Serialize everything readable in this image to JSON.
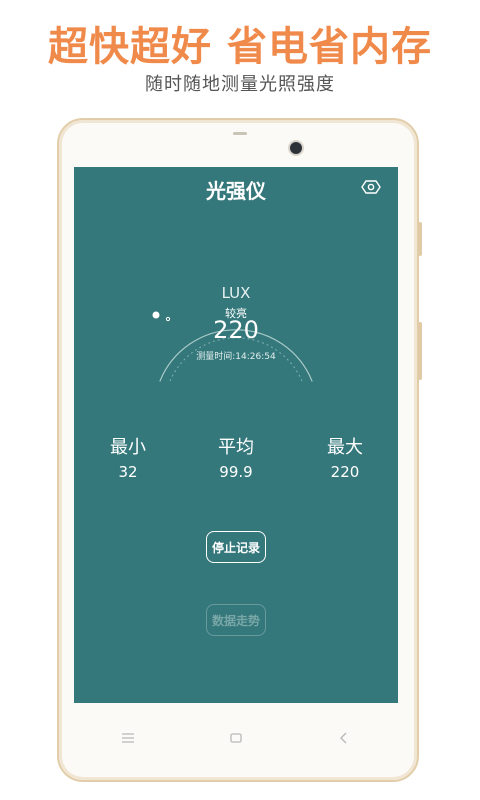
{
  "promo": {
    "headline": "超快超好  省电省内存",
    "subline": "随时随地测量光照强度"
  },
  "app": {
    "title": "光强仪",
    "eye_icon": "eye-icon",
    "meter": {
      "unit": "LUX",
      "level": "较亮",
      "value": "220",
      "time": "测量时间:14:26:54"
    },
    "stats": {
      "min_label": "最小",
      "min_value": "32",
      "avg_label": "平均",
      "avg_value": "99.9",
      "max_label": "最大",
      "max_value": "220"
    },
    "stop_button": "停止记录",
    "trend_button": "数据走势"
  },
  "navbar": {
    "menu_icon": "menu-icon",
    "home_icon": "home-icon",
    "back_icon": "back-icon"
  },
  "colors": {
    "screen": "#35787b",
    "headline": "#f08a4b",
    "frame": "#e2cda9"
  }
}
